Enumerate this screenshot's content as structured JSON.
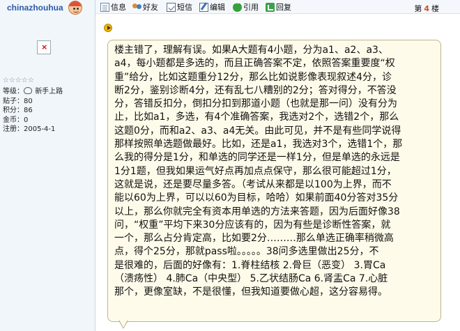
{
  "author": {
    "username": "chinazhouhua",
    "avatar": "avatar-icon",
    "stars": "☆☆☆☆☆",
    "info": [
      {
        "label": "等级：",
        "value": "新手上路"
      },
      {
        "label": "贴子：",
        "value": "80"
      },
      {
        "label": "积分：",
        "value": "86"
      },
      {
        "label": "金币：",
        "value": "0"
      },
      {
        "label": "注册：",
        "value": "2005-4-1"
      }
    ]
  },
  "toolbar": {
    "items": [
      {
        "label": "信息",
        "icon": "info-icon"
      },
      {
        "label": "好友",
        "icon": "friend-icon"
      },
      {
        "label": "短信",
        "icon": "message-icon"
      },
      {
        "label": "编辑",
        "icon": "edit-icon"
      },
      {
        "label": "引用",
        "icon": "quote-icon"
      },
      {
        "label": "回复",
        "icon": "reply-icon"
      }
    ],
    "floor_prefix": "第",
    "floor_number": "4",
    "floor_suffix": "楼"
  },
  "post": {
    "lines": [
      "楼主错了，理解有误。如果A大题有4小题，分为a1、a2、a3、",
      "a4，每小题都是多选的，而且正确答案不定，依照答案重要度“权",
      "重”给分，比如这题重分12分，那么比如说影像表现叙述4分，诊",
      "断2分，鉴别诊断4分，还有乱七八糟别的2分；答对得分，不答没",
      "分，答错反扣分，倒扣分扣到那道小题（也就是那一问）没有分为",
      "止，比如a1，多选，有4个准确答案，我选对2个，选错2个，那么",
      "这题0分，而和a2、a3、a4无关。由此可见，并不是有些同学说得",
      "那样按照单选题做最好。比如，还是a1，我选对3个，选错1个，那",
      "么我的得分是1分，和单选的同学还是一样1分，但是单选的永远是",
      "1分1题，但我如果运气好点再加点点保守，那么很可能超过1分，",
      "这就是说，还是要尽量多答。（考试从来都是以100为上界，而不",
      "能以60为上界，可以以60为目标，哈哈）如果前面40分答对35分",
      "以上，那么你就完全有资本用单选的方法来答题，因为后面好像38",
      "问，“权重”平均下来30分应该有的，因为有些是诊断性答案，就",
      "一个，那么占分肯定高，比如要2分………那么单选正确率稍微高",
      "点，得个25分，那就pass啦。。。。。38问多选里做出25分，不",
      "是很难的，后面的好像有：1.脊柱结核 2.骨巨（恶变） 3.胃Ca",
      "（溃疡性） 4.肺Ca（中央型） 5.乙状结肠Ca 6.肾盂Ca 7.心脏",
      "那个，更像室缺，不是很懂，但我知道要做心超，这分容易得。"
    ]
  }
}
